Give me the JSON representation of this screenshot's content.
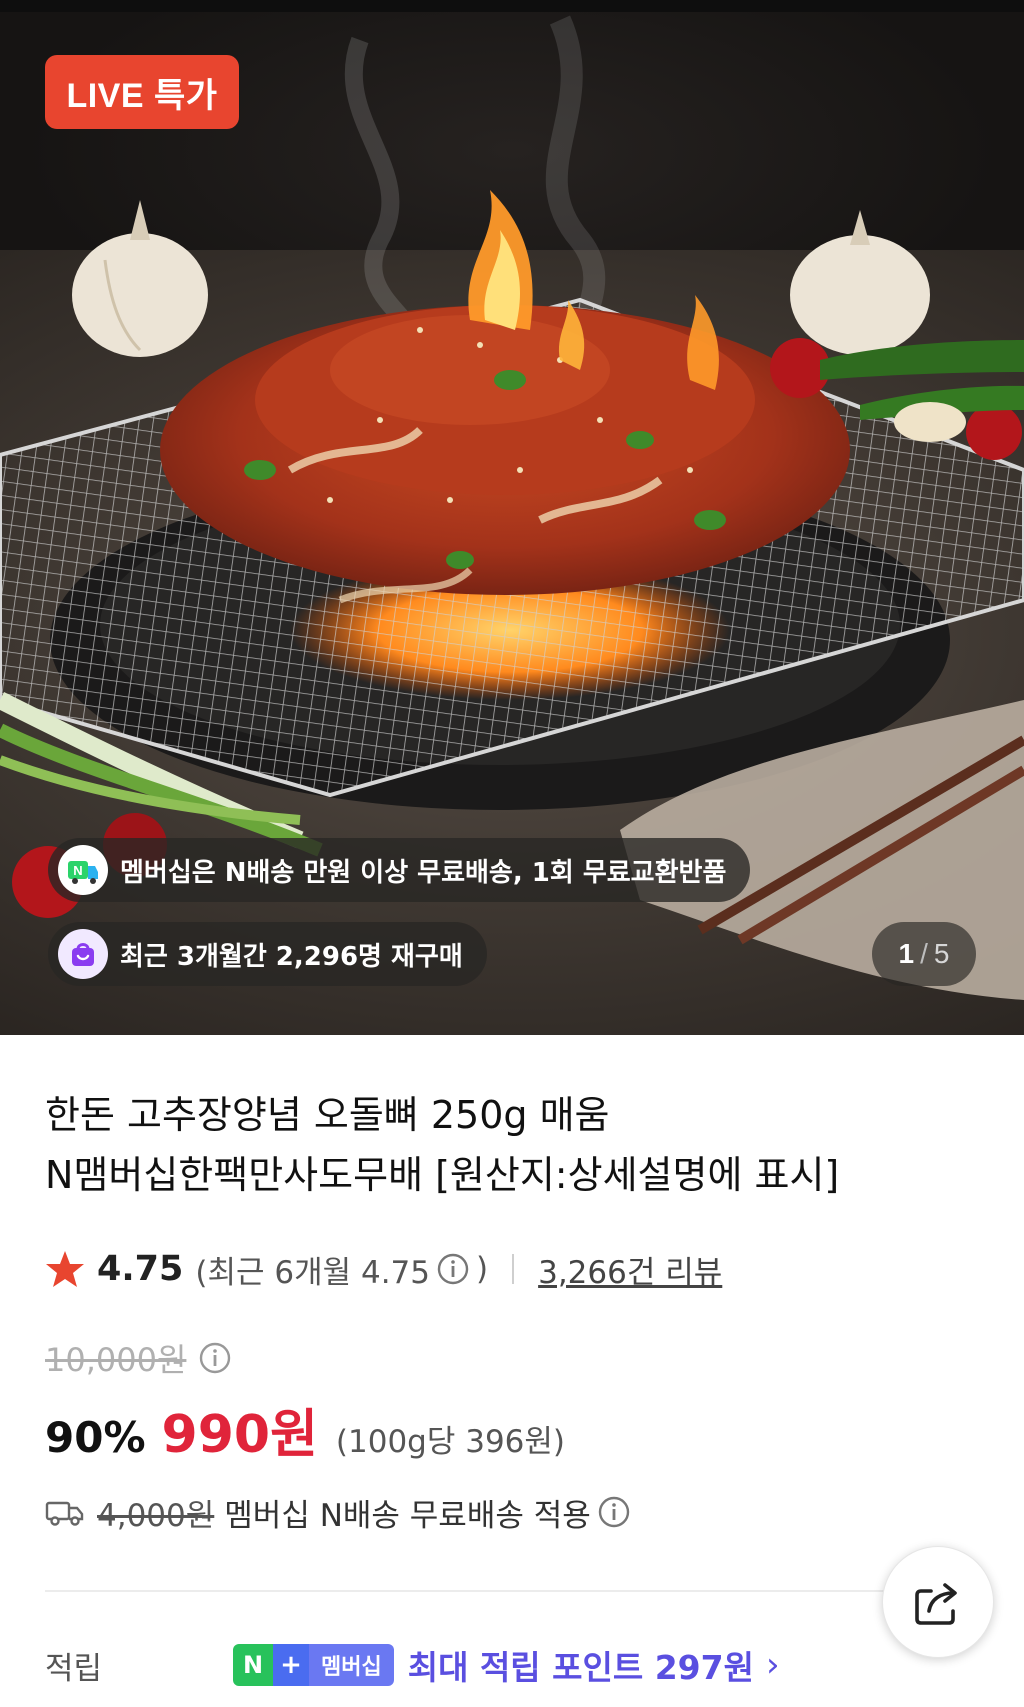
{
  "hero": {
    "badge": "LIVE 특가",
    "membership_pill": "멤버십은 N배송 만원 이상 무료배송, 1회 무료교환반품",
    "repurchase_pill": "최근 3개월간 2,296명 재구매",
    "page_current": "1",
    "page_total": "5"
  },
  "product": {
    "title_line1": "한돈 고추장양념 오돌뼈 250g 매움",
    "title_line2": "N맴버십한팩만사도무배 [원산지:상세설명에 표시]",
    "rating": "4.75",
    "recent_rating_open": "(최근 6개월 4.75",
    "recent_rating_close": ")",
    "review_count": "3,266건 리뷰",
    "original_price": "10,000원",
    "discount": "90%",
    "price": "990원",
    "unit_price": "(100g당 396원)",
    "delivery_old_fee": "4,000원",
    "delivery_text": "멤버십 N배송 무료배송 적용"
  },
  "points": {
    "label": "적립",
    "badge_n": "N",
    "badge_plus": "+",
    "badge_membership": "멤버십",
    "max_text": "최대 적립 포인트 297원",
    "chevron": "›"
  },
  "colors": {
    "live_badge": "#e8452f",
    "price_red": "#e0243a",
    "points_purple": "#5a4fe0",
    "n_green": "#28c25b"
  },
  "icons": [
    "star-icon",
    "info-icon",
    "truck-icon",
    "share-icon",
    "n-delivery-icon",
    "bag-icon",
    "chevron-right-icon"
  ]
}
